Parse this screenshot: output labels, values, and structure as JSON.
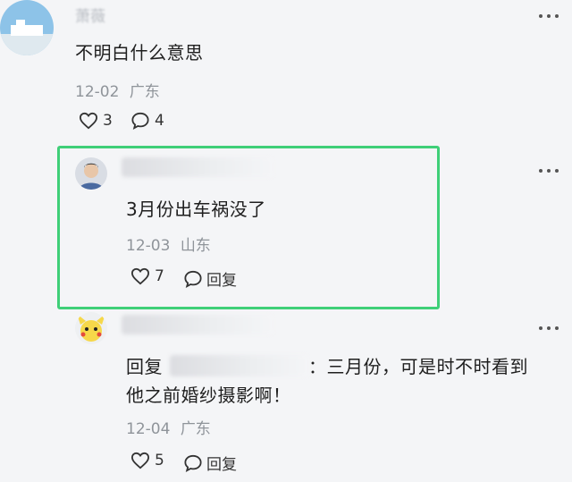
{
  "comments": [
    {
      "user": "萧薇",
      "text": "不明白什么意思",
      "date": "12-02",
      "location": "广东",
      "likes": "3",
      "replies": "4"
    },
    {
      "text": "3月份出车祸没了",
      "date": "12-03",
      "location": "山东",
      "likes": "7",
      "reply_label": "回复"
    },
    {
      "reply_prefix": "回复",
      "reply_text_line1": "：三月份，可是时不时看到",
      "reply_text_line2": "他之前婚纱摄影啊！",
      "date": "12-04",
      "location": "广东",
      "likes": "5",
      "reply_label": "回复"
    }
  ],
  "colors": {
    "highlight": "#3fcf78",
    "background": "#f4f5f7",
    "meta": "#8f949a"
  },
  "icons": [
    "heart-icon",
    "comment-icon",
    "more-icon"
  ]
}
